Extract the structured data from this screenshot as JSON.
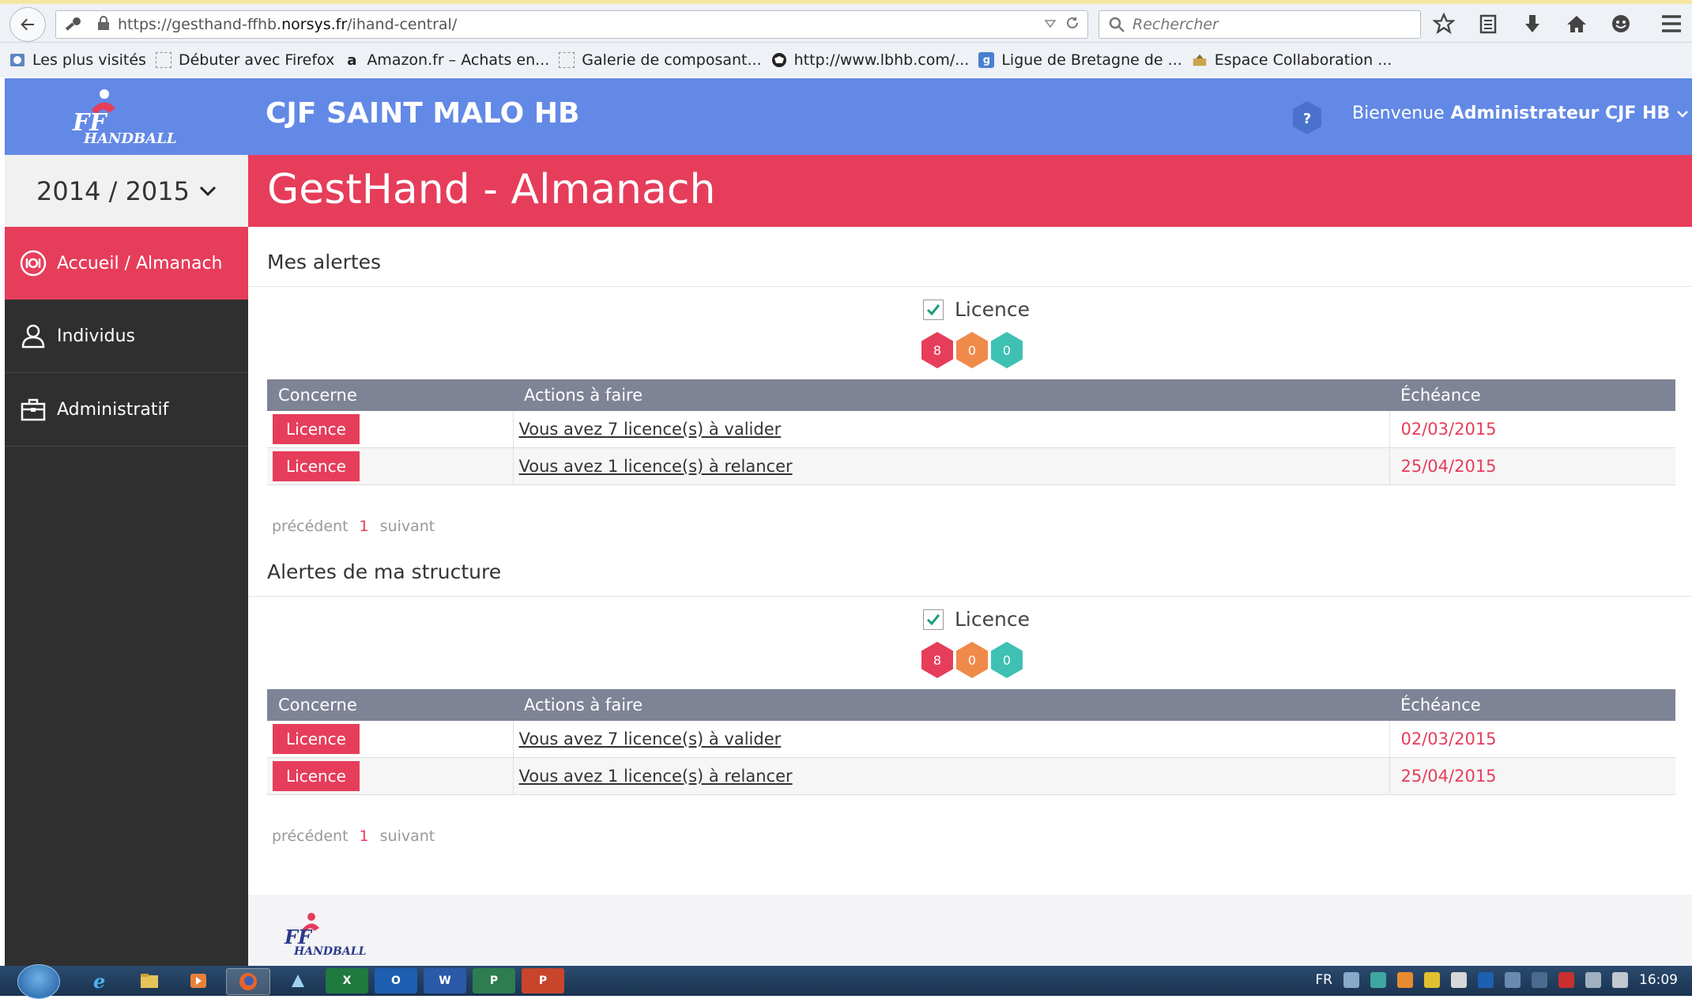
{
  "browser": {
    "url_prefix": "https://gesthand-ffhb.",
    "url_domain": "norsys.fr",
    "url_path": "/ihand-central/",
    "search_placeholder": "Rechercher",
    "bookmarks": [
      {
        "label": "Les plus visités",
        "icon": "globe-icon"
      },
      {
        "label": "Débuter avec Firefox",
        "icon": "dashed-box-icon"
      },
      {
        "label": "Amazon.fr – Achats en...",
        "icon": "amazon-icon"
      },
      {
        "label": "Galerie de composant...",
        "icon": "dashed-box-icon"
      },
      {
        "label": "http://www.lbhb.com/...",
        "icon": "ball-icon"
      },
      {
        "label": "Ligue de Bretagne de ...",
        "icon": "g-icon"
      },
      {
        "label": "Espace Collaboration ...",
        "icon": "folder-icon"
      }
    ]
  },
  "app": {
    "title": "CJF SAINT MALO HB",
    "logo_text": "FF HANDBALL",
    "welcome_prefix": "Bienvenue",
    "welcome_user": "Administrateur CJF HB",
    "help_label": "?"
  },
  "sidebar": {
    "season": "2014 / 2015",
    "items": [
      {
        "label": "Accueil / Almanach",
        "icon": "home-target-icon",
        "active": true
      },
      {
        "label": "Individus",
        "icon": "user-icon",
        "active": false
      },
      {
        "label": "Administratif",
        "icon": "briefcase-icon",
        "active": false
      }
    ]
  },
  "page": {
    "title": "GestHand - Almanach"
  },
  "sections": [
    {
      "title": "Mes alertes",
      "filter_label": "Licence",
      "counters": [
        {
          "value": "8",
          "color": "#e63d5b"
        },
        {
          "value": "0",
          "color": "#f08a4b"
        },
        {
          "value": "0",
          "color": "#3ec1b3"
        }
      ],
      "headers": [
        "Concerne",
        "Actions à faire",
        "Échéance"
      ],
      "rows": [
        {
          "concerne": "Licence",
          "action": "Vous avez 7 licence(s) à valider",
          "echeance": "02/03/2015"
        },
        {
          "concerne": "Licence",
          "action": "Vous avez 1 licence(s) à relancer",
          "echeance": "25/04/2015"
        }
      ],
      "pager": {
        "prev": "précédent",
        "current": "1",
        "next": "suivant"
      }
    },
    {
      "title": "Alertes de ma structure",
      "filter_label": "Licence",
      "counters": [
        {
          "value": "8",
          "color": "#e63d5b"
        },
        {
          "value": "0",
          "color": "#f08a4b"
        },
        {
          "value": "0",
          "color": "#3ec1b3"
        }
      ],
      "headers": [
        "Concerne",
        "Actions à faire",
        "Échéance"
      ],
      "rows": [
        {
          "concerne": "Licence",
          "action": "Vous avez 7 licence(s) à valider",
          "echeance": "02/03/2015"
        },
        {
          "concerne": "Licence",
          "action": "Vous avez 1 licence(s) à relancer",
          "echeance": "25/04/2015"
        }
      ],
      "pager": {
        "prev": "précédent",
        "current": "1",
        "next": "suivant"
      }
    }
  ],
  "taskbar": {
    "language": "FR",
    "clock": "16:09",
    "apps": [
      "ie-icon",
      "explorer-icon",
      "media-icon",
      "firefox-icon",
      "app-icon",
      "excel-icon",
      "outlook-icon",
      "word-icon",
      "project-icon",
      "powerpoint-icon"
    ]
  }
}
